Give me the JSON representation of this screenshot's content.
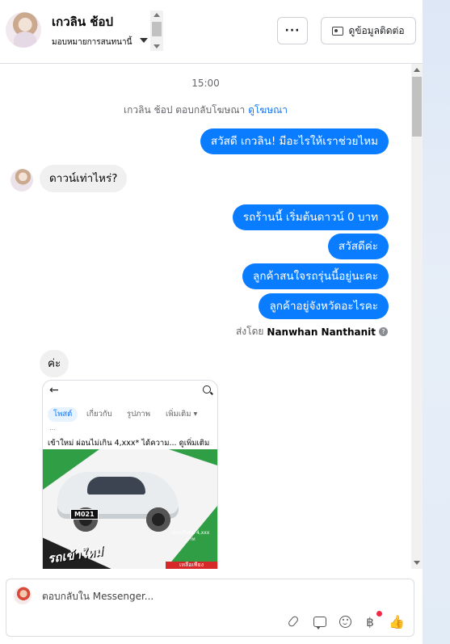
{
  "header": {
    "contact_name": "เกวลิน ช้อป",
    "assign_label": "มอบหมายการสนทนานี้",
    "more_label": "···",
    "info_button_label": "ดูข้อมูลติดต่อ"
  },
  "chat": {
    "timestamp": "15:00",
    "system_text": "เกวลิน ช้อป ตอบกลับโฆษณา",
    "system_link": "ดูโฆษณา",
    "messages": [
      {
        "direction": "out",
        "text": "สวัสดี เกวลิน! มีอะไรให้เราช่วยไหม"
      },
      {
        "direction": "in",
        "text": "ดาวน์เท่าไหร่?"
      },
      {
        "direction": "out",
        "text": "รถร้านนี้ เริ่มต้นดาวน์ 0 บาท"
      },
      {
        "direction": "out",
        "text": "สวัสดีค่ะ"
      },
      {
        "direction": "out",
        "text": "ลูกค้าสนใจรถรุ่นนี้อยู่นะคะ"
      },
      {
        "direction": "out",
        "text": "ลูกค้าอยู่จังหวัดอะไรคะ"
      },
      {
        "direction": "in",
        "text": "ค่ะ"
      }
    ],
    "sent_by_prefix": "ส่งโดย",
    "sent_by_name": "Nanwhan Nanthanit",
    "attachment": {
      "tabs": [
        "โพสต์",
        "เกี่ยวกับ",
        "รูปภาพ",
        "เพิ่มเติม ▾"
      ],
      "caption": "เข้าใหม่ ผ่อนไม่เกิน 4,xxx* ได้ความ... ดูเพิ่มเติม",
      "plate": "M021",
      "promo_text": "รถเข้าใหม่",
      "payment_text": "ผ่อนเริ่มต้น 4,xxx บาท",
      "red_label": "เหลือเพียง"
    }
  },
  "composer": {
    "placeholder": "ตอบกลับใน Messenger...",
    "value": ""
  },
  "icons": {
    "attach": "paperclip-icon",
    "saved_reply": "chat-bubble-icon",
    "emoji": "smiley-icon",
    "payment": "baht-icon",
    "like": "thumbs-up-icon"
  },
  "colors": {
    "accent": "#0a7cff",
    "link": "#1877f2",
    "incoming_bubble": "#f0f0f0",
    "notification": "#f02849"
  }
}
